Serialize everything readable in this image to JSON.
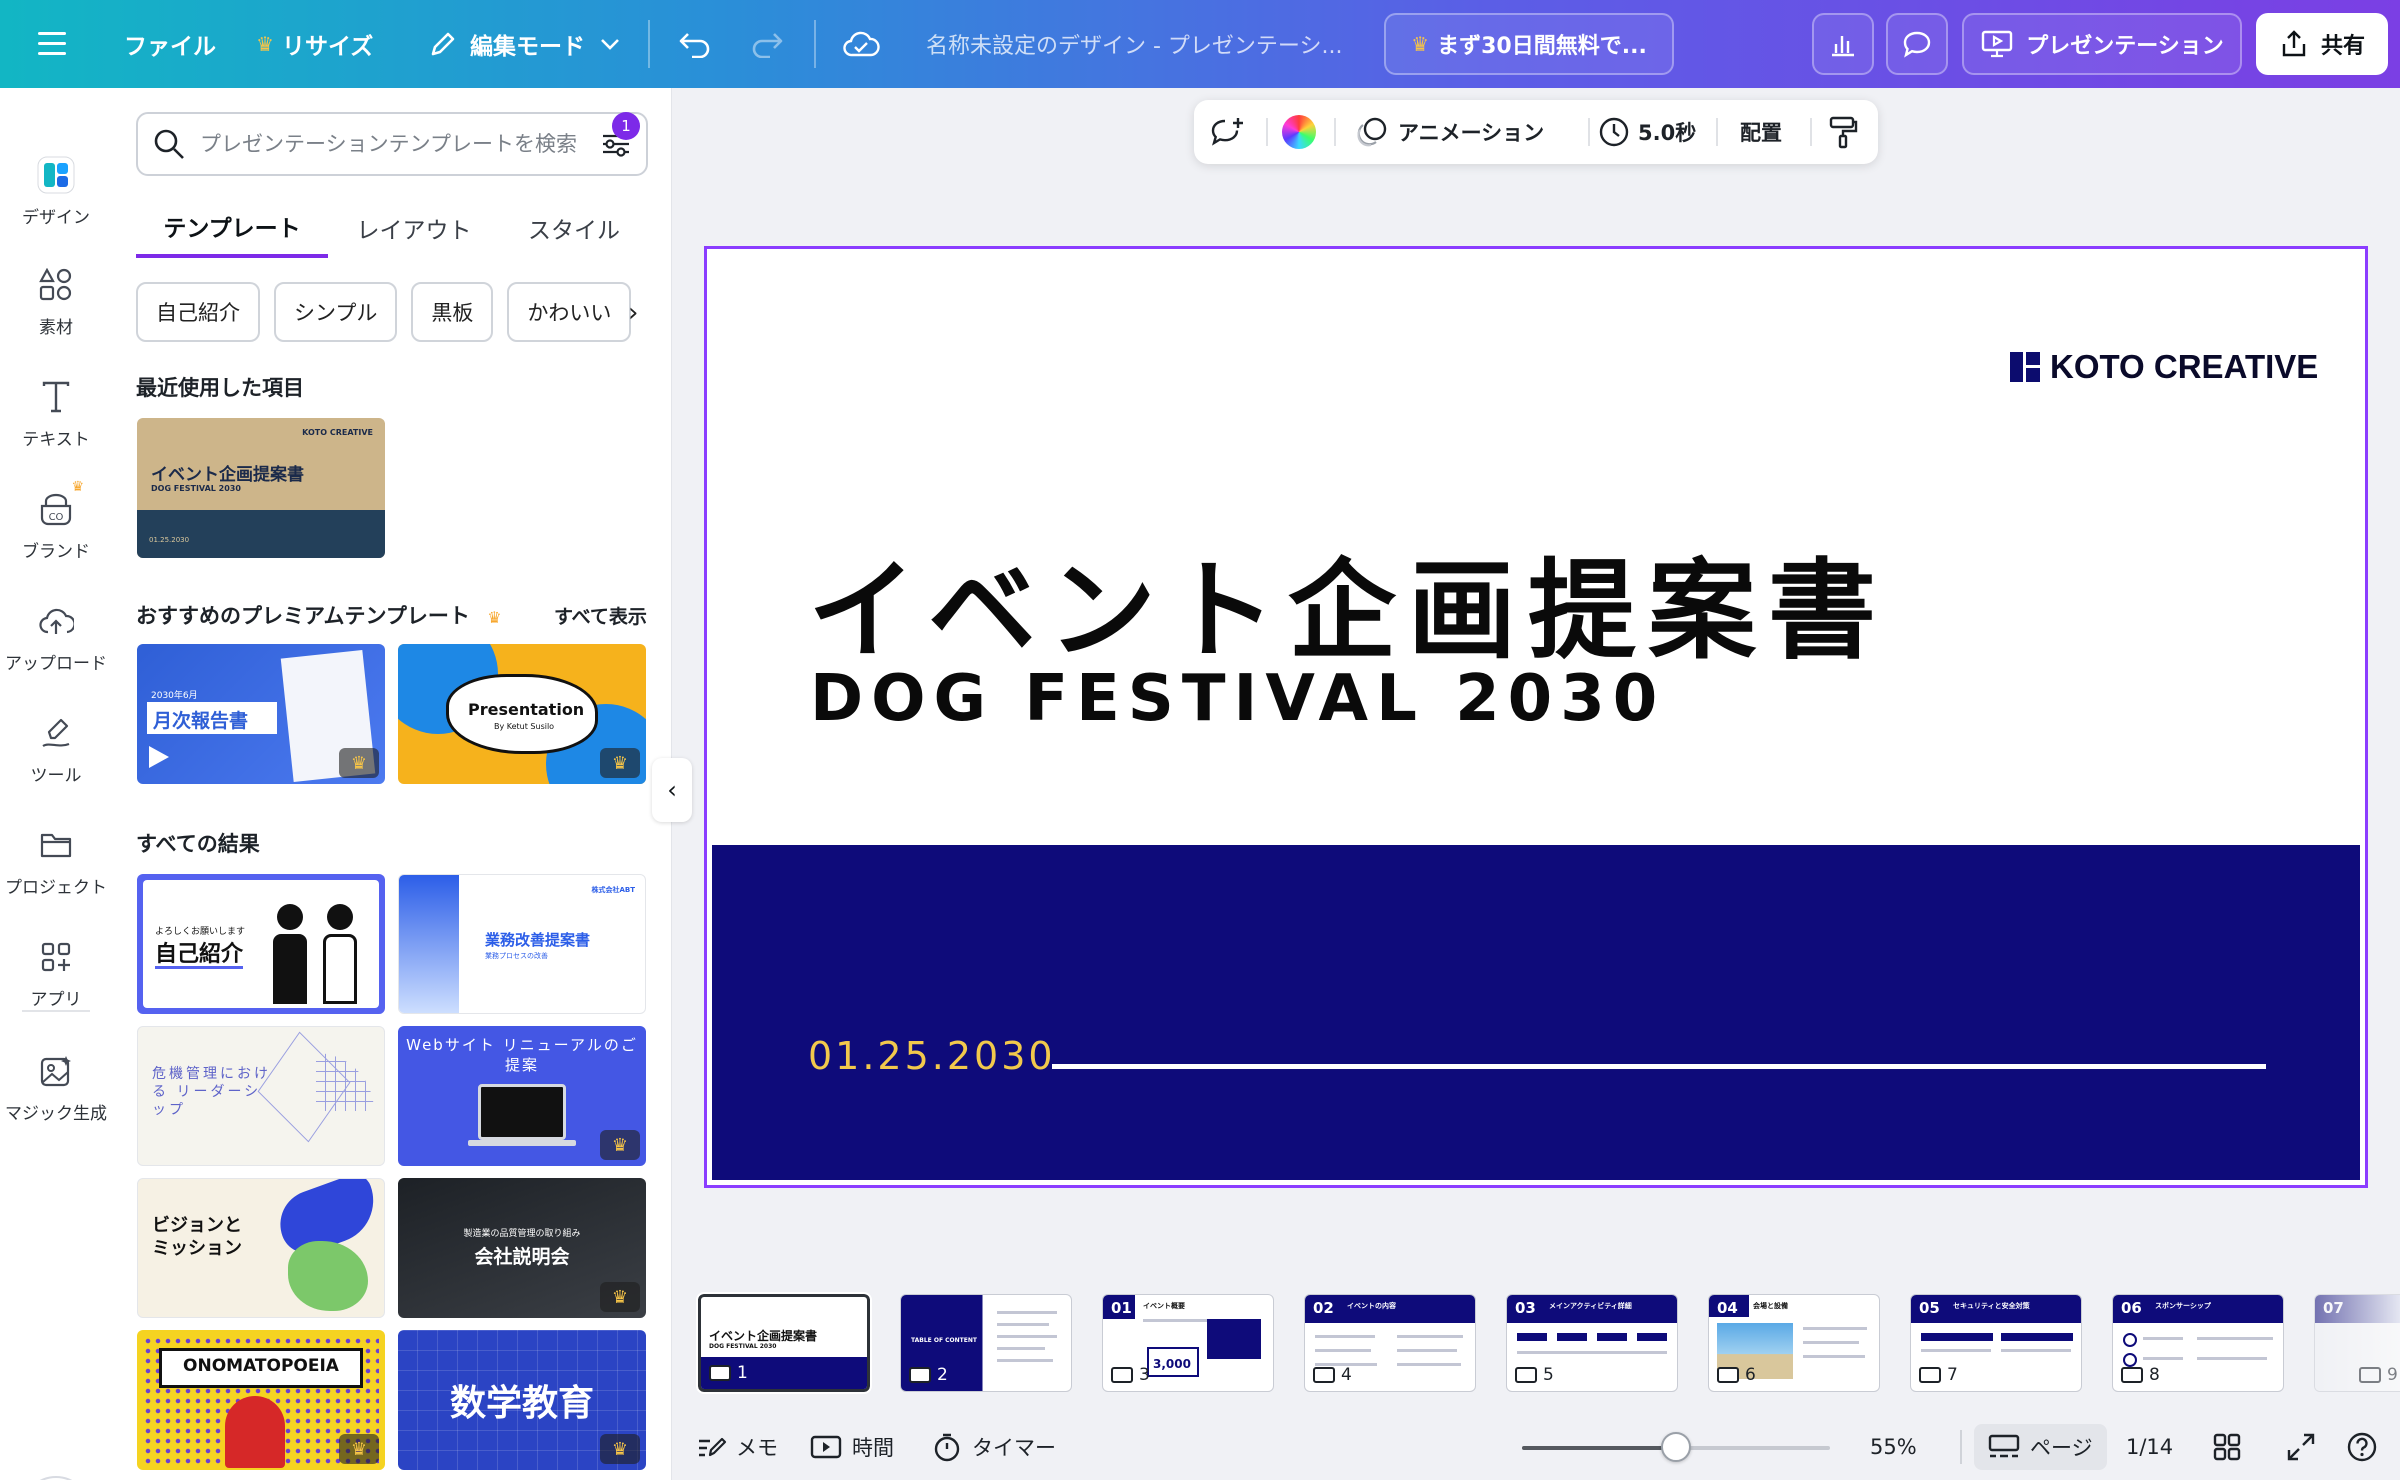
{
  "topbar": {
    "file": "ファイル",
    "resize": "リサイズ",
    "edit_mode": "編集モード",
    "doc_title": "名称未設定のデザイン - プレゼンテーシ...",
    "trial": "まず30日間無料で...",
    "present": "プレゼンテーション",
    "share": "共有"
  },
  "rail": {
    "items": [
      {
        "label": "デザイン"
      },
      {
        "label": "素材"
      },
      {
        "label": "テキスト"
      },
      {
        "label": "ブランド"
      },
      {
        "label": "アップロード"
      },
      {
        "label": "ツール"
      },
      {
        "label": "プロジェクト"
      },
      {
        "label": "アプリ"
      },
      {
        "label": "マジック生成"
      }
    ]
  },
  "panel": {
    "search_placeholder": "プレゼンテーションテンプレートを検索",
    "filter_count": "1",
    "tabs": [
      "テンプレート",
      "レイアウト",
      "スタイル"
    ],
    "chips": [
      "自己紹介",
      "シンプル",
      "黒板",
      "かわいい"
    ],
    "recent_title": "最近使用した項目",
    "recent_thumb": {
      "title": "イベント企画提案書",
      "sub": "DOG FESTIVAL 2030",
      "brand": "KOTO CREATIVE",
      "date": "01.25.2030"
    },
    "premium_title": "おすすめのプレミアムテンプレート",
    "see_all": "すべて表示",
    "premium": [
      {
        "small": "2030年6月",
        "title": "月次報告書"
      },
      {
        "title": "Presentation",
        "sub": "By Ketut Susilo"
      }
    ],
    "results_title": "すべての結果",
    "results": [
      {
        "small": "よろしくお願いします",
        "title": "自己紹介"
      },
      {
        "title": "業務改善提案書",
        "sub": "業務プロセスの改善",
        "brand": "株式会社ABT"
      },
      {
        "title": "危機管理における リーダーシップ"
      },
      {
        "title": "Webサイト リニューアルのご提案"
      },
      {
        "title": "ビジョンと ミッション"
      },
      {
        "small": "製造業の品質管理の取り組み",
        "title": "会社説明会"
      },
      {
        "title": "ONOMATOPOEIA"
      },
      {
        "title": "数学教育"
      }
    ]
  },
  "context": {
    "animation": "アニメーション",
    "duration": "5.0秒",
    "position": "配置"
  },
  "slide": {
    "brand": "KOTO CREATIVE",
    "title": "イベント企画提案書",
    "subtitle": "DOG FESTIVAL 2030",
    "date": "01.25.2030",
    "colors": {
      "band": "#0e0b7a",
      "date": "#f2c94c"
    }
  },
  "filmstrip": [
    {
      "num": "1",
      "title": "イベント企画提案書",
      "sub": "DOG FESTIVAL 2030"
    },
    {
      "num": "2",
      "label": "TABLE OF CONTENT"
    },
    {
      "num": "3",
      "sec": "01",
      "head": "イベント概要",
      "big": "3,000"
    },
    {
      "num": "4",
      "sec": "02",
      "head": "イベントの内容"
    },
    {
      "num": "5",
      "sec": "03",
      "head": "メインアクティビティ詳細"
    },
    {
      "num": "6",
      "sec": "04",
      "head": "会場と設備"
    },
    {
      "num": "7",
      "sec": "05",
      "head": "セキュリティと安全対策"
    },
    {
      "num": "8",
      "sec": "06",
      "head": "スポンサーシップ"
    },
    {
      "num": "9",
      "sec": "07"
    }
  ],
  "bottombar": {
    "notes": "メモ",
    "timing": "時間",
    "timer": "タイマー",
    "zoom": "55%",
    "zoom_fraction": 0.55,
    "pages": "ページ",
    "page_count": "1/14"
  }
}
